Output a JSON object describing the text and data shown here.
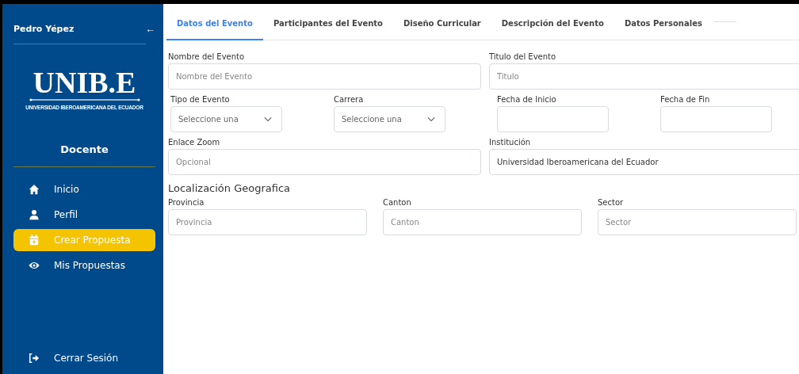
{
  "sidebar": {
    "user": "Pedro Yépez",
    "collapse_icon": "←",
    "logo": {
      "wordmark": "UNIB.E",
      "caption": "UNIVERSIDAD IBEROAMERICANA DEL ECUADOR"
    },
    "role": "Docente",
    "items": [
      {
        "label": "Inicio",
        "kind": "home",
        "selected": false
      },
      {
        "label": "Perfil",
        "kind": "user",
        "selected": false
      },
      {
        "label": "Crear Propuesta",
        "kind": "calendar",
        "selected": true
      },
      {
        "label": "Mis Propuestas",
        "kind": "eye",
        "selected": false
      }
    ],
    "logout": {
      "label": "Cerrar Sesión",
      "kind": "logout"
    }
  },
  "tabs": [
    {
      "label": "Datos del Evento",
      "selected": true
    },
    {
      "label": "Participantes del Evento",
      "selected": false
    },
    {
      "label": "Diseño Curricular",
      "selected": false
    },
    {
      "label": "Descripción del Evento",
      "selected": false
    },
    {
      "label": "Datos Personales",
      "selected": false
    }
  ],
  "form": {
    "rows": [
      [
        {
          "label": "Nombre del Evento",
          "kind": "text",
          "placeholder": "Nombre del Evento"
        },
        {
          "label": "Titulo del Evento",
          "kind": "text",
          "placeholder": "Titulo"
        }
      ],
      [
        {
          "label": "Tipo de Evento",
          "kind": "select",
          "value": "Seleccione una"
        },
        {
          "label": "Carrera",
          "kind": "select",
          "value": "Seleccione una"
        },
        {
          "label": "Fecha de Inicio",
          "kind": "date"
        },
        {
          "label": "Fecha de Fin",
          "kind": "date"
        }
      ],
      [
        {
          "label": "Enlace Zoom",
          "kind": "text",
          "placeholder": "Opcional"
        },
        {
          "label": "Institución",
          "kind": "text",
          "value": "Universidad Iberoamericana del Ecuador"
        }
      ]
    ],
    "section_title": "Localización Geografica",
    "location": [
      {
        "label": "Provincia",
        "kind": "text",
        "placeholder": "Provincia"
      },
      {
        "label": "Canton",
        "kind": "text",
        "placeholder": "Canton"
      },
      {
        "label": "Sector",
        "kind": "text",
        "placeholder": "Sector"
      }
    ]
  }
}
